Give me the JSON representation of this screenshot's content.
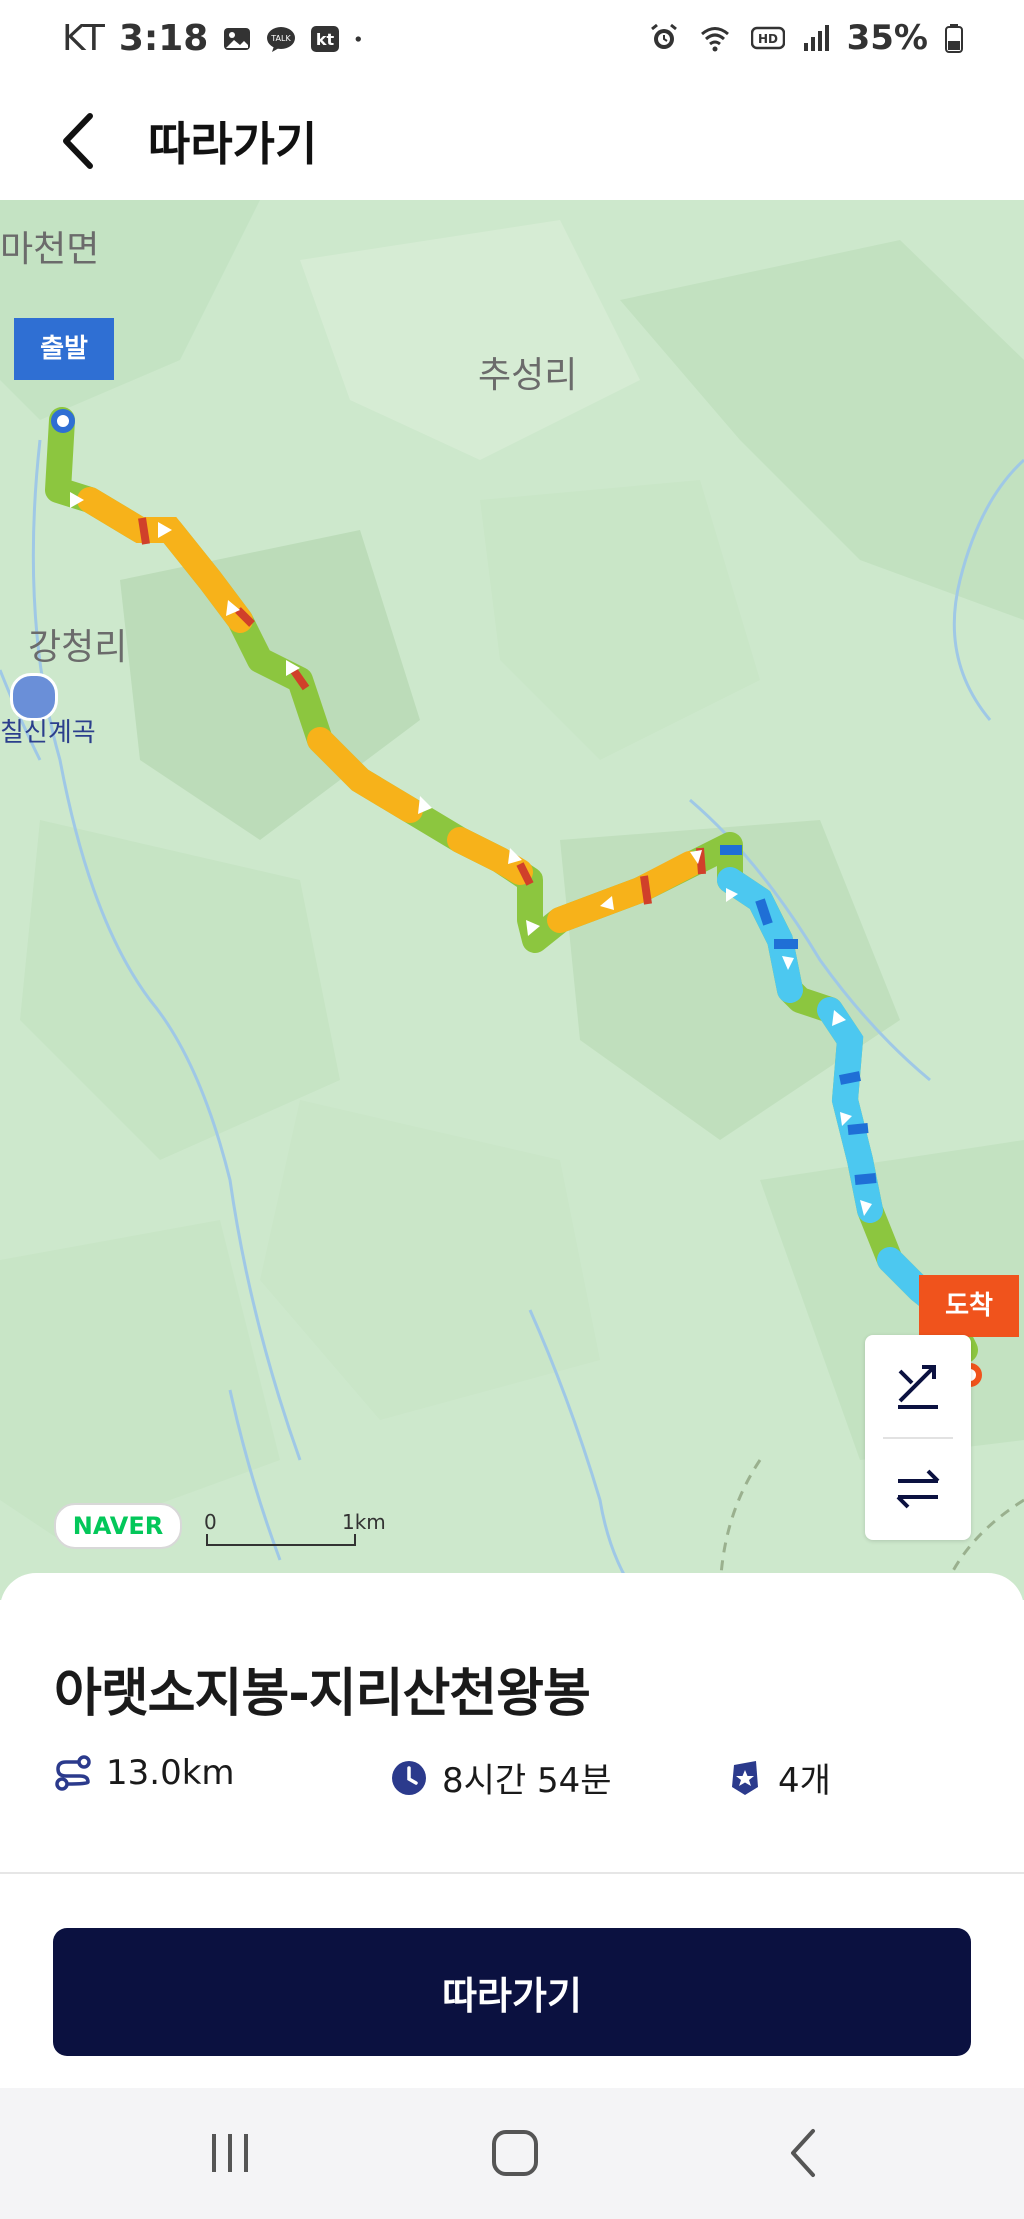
{
  "status_bar": {
    "carrier": "KT",
    "time": "3:18",
    "battery": "35%",
    "talk_badge": "TALK",
    "kt_badge": "kt",
    "hd_badge": "HD",
    "icons_left": [
      "gallery-icon",
      "kakaotalk-icon",
      "kt-icon",
      "dot-icon"
    ],
    "icons_right": [
      "alarm-icon",
      "wifi-icon",
      "hd-icon",
      "signal-icon",
      "battery-icon"
    ]
  },
  "header": {
    "title": "따라가기",
    "back_icon": "chevron-left-icon"
  },
  "map": {
    "places": [
      "마천면",
      "추성리",
      "강청리",
      "칠신계곡"
    ],
    "start_label": "출발",
    "end_label": "도착",
    "naver_logo": "NAVER",
    "scale_start": "0",
    "scale_end": "1km",
    "controls": [
      "slope-toggle-icon",
      "swap-direction-icon"
    ],
    "colors": {
      "route_green": "#8cc63f",
      "route_orange": "#f7b21a",
      "route_red": "#d0402a",
      "route_cyan": "#4cc8f0",
      "route_blue": "#1f6fd6",
      "start": "#2f6fd3",
      "end": "#f0531c"
    }
  },
  "route": {
    "title": "아랫소지봉-지리산천왕봉",
    "distance": "13.0km",
    "duration": "8시간 54분",
    "count": "4개",
    "icons": [
      "route-distance-icon",
      "clock-icon",
      "badge-icon"
    ]
  },
  "actions": {
    "follow_label": "따라가기"
  },
  "nav": {
    "items": [
      "recent-apps-icon",
      "home-icon",
      "back-icon"
    ]
  }
}
